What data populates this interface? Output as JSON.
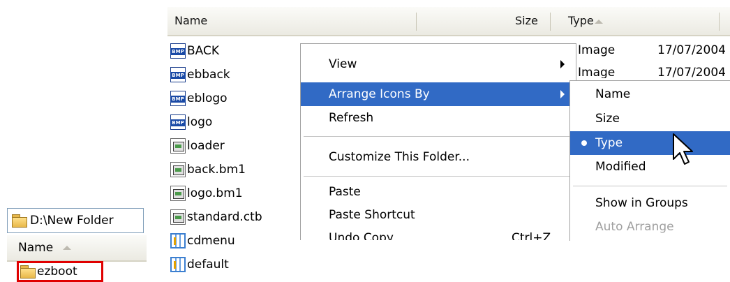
{
  "list": {
    "headers": {
      "name": "Name",
      "size": "Size",
      "type": "Type"
    },
    "rows": [
      {
        "name": "BACK",
        "icon": "bmp-file-icon"
      },
      {
        "name": "ebback",
        "icon": "bmp-file-icon"
      },
      {
        "name": "eblogo",
        "icon": "bmp-file-icon"
      },
      {
        "name": "logo",
        "icon": "bmp-file-icon"
      },
      {
        "name": "loader",
        "icon": "document-icon"
      },
      {
        "name": "back.bm1",
        "icon": "document-icon"
      },
      {
        "name": "logo.bm1",
        "icon": "document-icon"
      },
      {
        "name": "standard.ctb",
        "icon": "document-icon"
      },
      {
        "name": "cdmenu",
        "icon": "grid-file-icon"
      },
      {
        "name": "default",
        "icon": "grid-file-icon"
      }
    ],
    "partial_rows": [
      {
        "type": "Image",
        "date": "17/07/2004"
      },
      {
        "type": "Image",
        "date": "17/07/2004"
      }
    ]
  },
  "left_window": {
    "address": "D:\\New Folder",
    "header_name": "Name",
    "selected_item": "ezboot"
  },
  "context_menu": {
    "items": [
      {
        "label": "View",
        "submenu": true
      },
      {
        "label": "Arrange Icons By",
        "submenu": true,
        "highlighted": true
      },
      {
        "label": "Refresh"
      },
      {
        "label": "Customize This Folder..."
      },
      {
        "label": "Paste"
      },
      {
        "label": "Paste Shortcut"
      },
      {
        "label": "Undo Copy",
        "shortcut": "Ctrl+Z"
      }
    ]
  },
  "submenu": {
    "items": [
      {
        "label": "Name"
      },
      {
        "label": "Size"
      },
      {
        "label": "Type",
        "checked": true,
        "highlighted": true
      },
      {
        "label": "Modified"
      },
      {
        "label": "Show in Groups"
      },
      {
        "label": "Auto Arrange",
        "disabled": true
      }
    ]
  },
  "colors": {
    "highlight": "#316ac5",
    "selection_box": "#e00000"
  }
}
